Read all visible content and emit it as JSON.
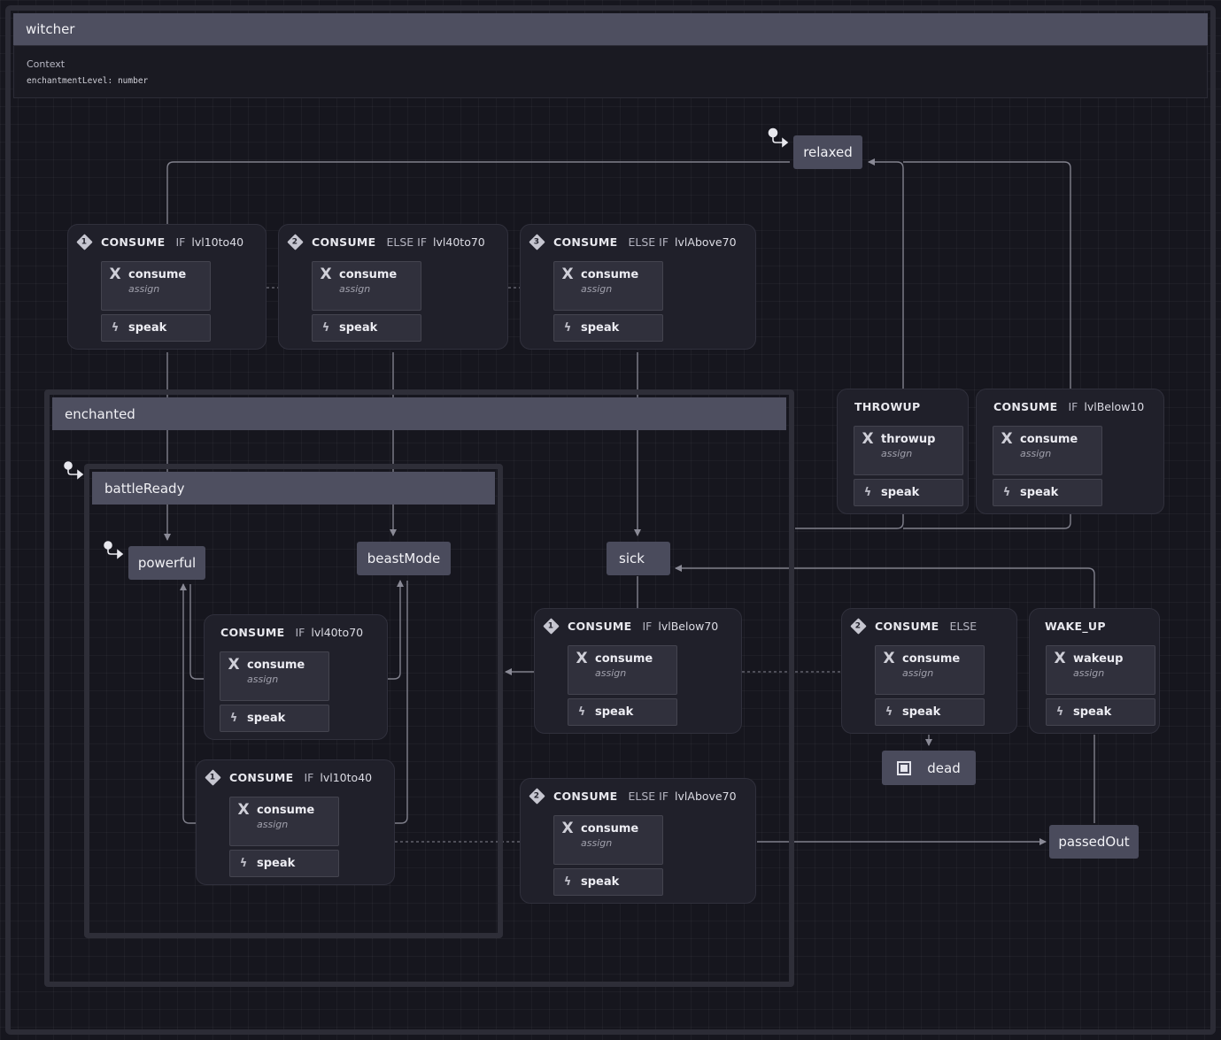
{
  "machine": {
    "name": "witcher",
    "context_title": "Context",
    "context_fields": [
      "enchantmentLevel: number"
    ]
  },
  "states": {
    "relaxed": "relaxed",
    "enchanted": "enchanted",
    "battleReady": "battleReady",
    "powerful": "powerful",
    "beastMode": "beastMode",
    "sick": "sick",
    "dead": "dead",
    "passedOut": "passedOut"
  },
  "transitions": [
    {
      "id": "t1",
      "index": "1",
      "event": "CONSUME",
      "guard_kw": "IF",
      "guard": "lvl10to40",
      "action": "consume",
      "action_type": "assign",
      "effect": "speak"
    },
    {
      "id": "t2",
      "index": "2",
      "event": "CONSUME",
      "guard_kw": "ELSE IF",
      "guard": "lvl40to70",
      "action": "consume",
      "action_type": "assign",
      "effect": "speak"
    },
    {
      "id": "t3",
      "index": "3",
      "event": "CONSUME",
      "guard_kw": "ELSE IF",
      "guard": "lvlAbove70",
      "action": "consume",
      "action_type": "assign",
      "effect": "speak"
    },
    {
      "id": "t4",
      "index": "",
      "event": "THROWUP",
      "guard_kw": "",
      "guard": "",
      "action": "throwup",
      "action_type": "assign",
      "effect": "speak"
    },
    {
      "id": "t5",
      "index": "",
      "event": "CONSUME",
      "guard_kw": "IF",
      "guard": "lvlBelow10",
      "action": "consume",
      "action_type": "assign",
      "effect": "speak"
    },
    {
      "id": "t6",
      "index": "",
      "event": "CONSUME",
      "guard_kw": "IF",
      "guard": "lvl40to70",
      "action": "consume",
      "action_type": "assign",
      "effect": "speak"
    },
    {
      "id": "t7",
      "index": "1",
      "event": "CONSUME",
      "guard_kw": "IF",
      "guard": "lvl10to40",
      "action": "consume",
      "action_type": "assign",
      "effect": "speak"
    },
    {
      "id": "t8",
      "index": "1",
      "event": "CONSUME",
      "guard_kw": "IF",
      "guard": "lvlBelow70",
      "action": "consume",
      "action_type": "assign",
      "effect": "speak"
    },
    {
      "id": "t9",
      "index": "2",
      "event": "CONSUME",
      "guard_kw": "ELSE",
      "guard": "",
      "action": "consume",
      "action_type": "assign",
      "effect": "speak"
    },
    {
      "id": "t10",
      "index": "",
      "event": "WAKE_UP",
      "guard_kw": "",
      "guard": "",
      "action": "wakeup",
      "action_type": "assign",
      "effect": "speak"
    },
    {
      "id": "t11",
      "index": "2",
      "event": "CONSUME",
      "guard_kw": "ELSE IF",
      "guard": "lvlAbove70",
      "action": "consume",
      "action_type": "assign",
      "effect": "speak"
    }
  ],
  "icons": {
    "initial": "initial-state-icon",
    "action": "x-assign-icon",
    "effect": "bolt-icon",
    "final": "final-state-icon"
  },
  "colors": {
    "background": "#16161e",
    "state": "#4a4b5c",
    "header": "#4e4f60",
    "edge": "#8a8a96"
  }
}
